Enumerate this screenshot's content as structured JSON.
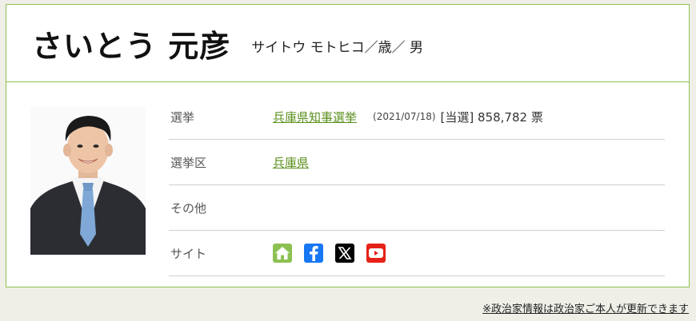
{
  "profile": {
    "name": "さいとう 元彦",
    "kana_age_gender": "サイトウ モトヒコ／歳／ 男"
  },
  "rows": {
    "election": {
      "label": "選挙",
      "link": "兵庫県知事選挙",
      "date": "(2021/07/18)",
      "result": "[当選] 858,782 票"
    },
    "district": {
      "label": "選挙区",
      "link": "兵庫県"
    },
    "other": {
      "label": "その他"
    },
    "site": {
      "label": "サイト",
      "icons": [
        "home-icon",
        "facebook-icon",
        "x-icon",
        "youtube-icon"
      ]
    }
  },
  "footer_note": "※政治家情報は政治家ご本人が更新できます",
  "colors": {
    "accent_green": "#8cc152",
    "link_green": "#5a8f1c",
    "facebook_blue": "#1877f2",
    "youtube_red": "#e62117",
    "background": "#efefe8"
  }
}
